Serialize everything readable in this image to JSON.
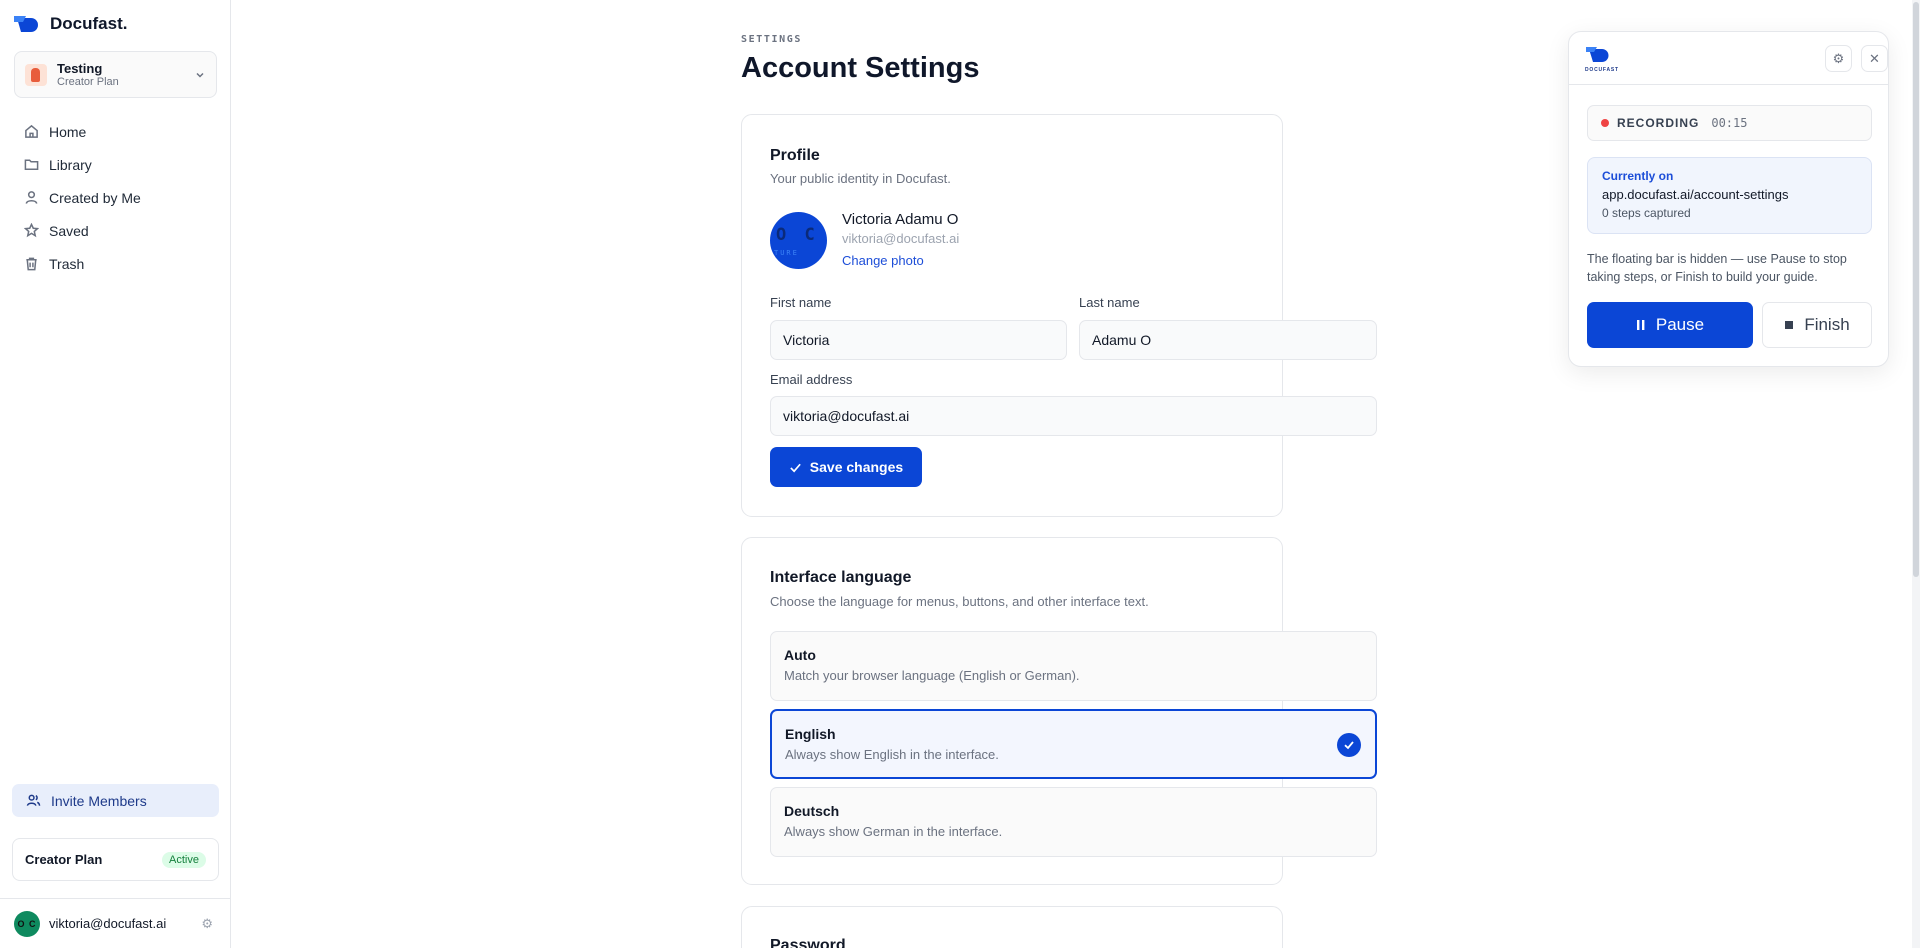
{
  "brand": {
    "name": "Docufast."
  },
  "workspace": {
    "name": "Testing",
    "plan": "Creator Plan"
  },
  "nav": [
    {
      "label": "Home",
      "icon": "home-icon"
    },
    {
      "label": "Library",
      "icon": "folder-icon"
    },
    {
      "label": "Created by Me",
      "icon": "user-icon"
    },
    {
      "label": "Saved",
      "icon": "star-icon"
    },
    {
      "label": "Trash",
      "icon": "trash-icon"
    }
  ],
  "invite_label": "Invite Members",
  "plan_card": {
    "name": "Creator Plan",
    "status": "Active"
  },
  "user": {
    "email": "viktoria@docufast.ai",
    "initials": "O C"
  },
  "page": {
    "eyebrow": "SETTINGS",
    "title": "Account Settings"
  },
  "profile": {
    "title": "Profile",
    "subtitle": "Your public identity in Docufast.",
    "avatar_initials": "O C",
    "avatar_small_text": "TURE",
    "name": "Victoria Adamu O",
    "email": "viktoria@docufast.ai",
    "change_photo": "Change photo",
    "first_name_label": "First name",
    "first_name_value": "Victoria",
    "last_name_label": "Last name",
    "last_name_value": "Adamu O",
    "email_label": "Email address",
    "email_value": "viktoria@docufast.ai",
    "save_label": "Save changes"
  },
  "language": {
    "title": "Interface language",
    "subtitle": "Choose the language for menus, buttons, and other interface text.",
    "options": [
      {
        "title": "Auto",
        "desc": "Match your browser language (English or German).",
        "selected": false
      },
      {
        "title": "English",
        "desc": "Always show English in the interface.",
        "selected": true
      },
      {
        "title": "Deutsch",
        "desc": "Always show German in the interface.",
        "selected": false
      }
    ]
  },
  "password": {
    "title": "Password"
  },
  "recorder": {
    "logo_text": "DOCUFAST",
    "status_label": "RECORDING",
    "time": "00:15",
    "current_label": "Currently on",
    "current_url": "app.docufast.ai/account-settings",
    "steps": "0 steps captured",
    "note": "The floating bar is hidden — use Pause to stop taking steps, or Finish to build your guide.",
    "pause_label": "Pause",
    "finish_label": "Finish"
  },
  "colors": {
    "accent": "#0b46d6",
    "recording": "#ef4444",
    "active_badge": "#15803d"
  }
}
